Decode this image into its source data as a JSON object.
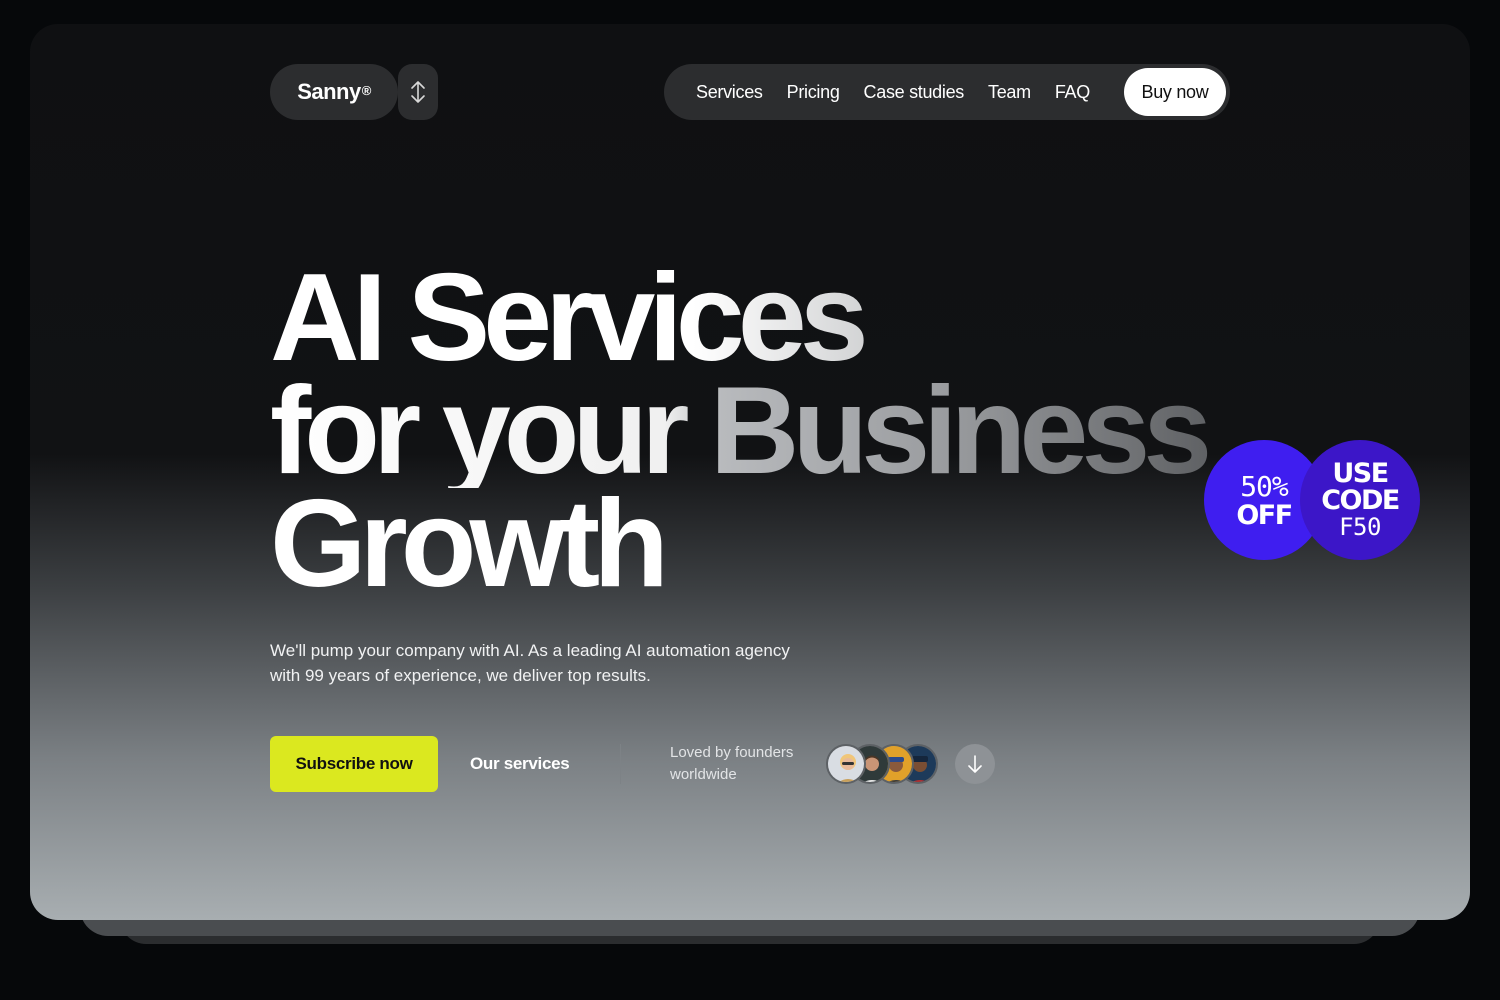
{
  "brand": {
    "name": "Sanny",
    "mark": "®"
  },
  "nav": {
    "items": [
      "Services",
      "Pricing",
      "Case studies",
      "Team",
      "FAQ"
    ],
    "cta": "Buy now"
  },
  "hero": {
    "line1": "AI Services",
    "line2a": "for your",
    "line2b": "Business",
    "line3": "Growth",
    "description_line1": "We'll pump your company with AI. As a leading AI automation agency",
    "description_line2": "with 99 years of experience, we deliver top results."
  },
  "actions": {
    "subscribe": "Subscribe now",
    "services": "Our services"
  },
  "social_proof": {
    "line1": "Loved by founders",
    "line2": "worldwide"
  },
  "promo": {
    "discount_line1": "50%",
    "discount_line2": "OFF",
    "code_line1": "USE",
    "code_line2": "CODE",
    "code_line3": "F50"
  },
  "colors": {
    "accent_yellow": "#dbe81f",
    "badge_purple": "#3f1ef0",
    "badge_purple_dark": "#3c16c8"
  },
  "icons": [
    "switch-arrows-icon",
    "arrow-down-icon"
  ]
}
